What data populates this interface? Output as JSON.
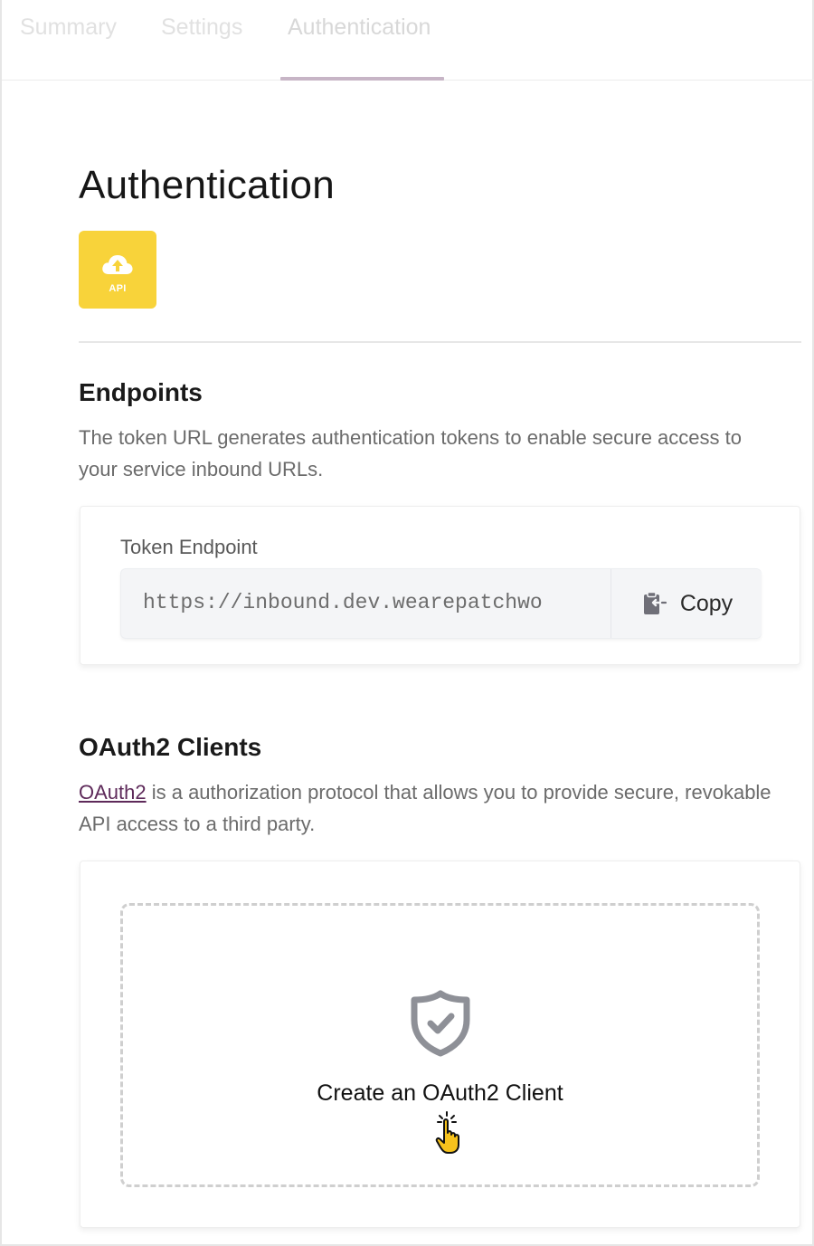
{
  "tabs": [
    {
      "label": "Summary"
    },
    {
      "label": "Settings"
    },
    {
      "label": "Authentication",
      "active": true
    }
  ],
  "page": {
    "title": "Authentication",
    "badge_label": "API",
    "badge_icon": "cloud-upload-icon",
    "badge_color": "#f8d33a"
  },
  "endpoints": {
    "title": "Endpoints",
    "description": "The token URL generates authentication tokens to enable secure access to your service inbound URLs.",
    "token_label": "Token Endpoint",
    "token_url": "https://inbound.dev.wearepatchwo",
    "copy_label": "Copy",
    "copy_icon": "clipboard-icon"
  },
  "oauth": {
    "title": "OAuth2 Clients",
    "link_text": "OAuth2",
    "description_rest": " is a authorization protocol that allows you to provide secure, revokable API access to a third party.",
    "empty_icon": "shield-check-icon",
    "create_label": "Create an OAuth2 Client",
    "link_color": "#5e2a5a"
  }
}
